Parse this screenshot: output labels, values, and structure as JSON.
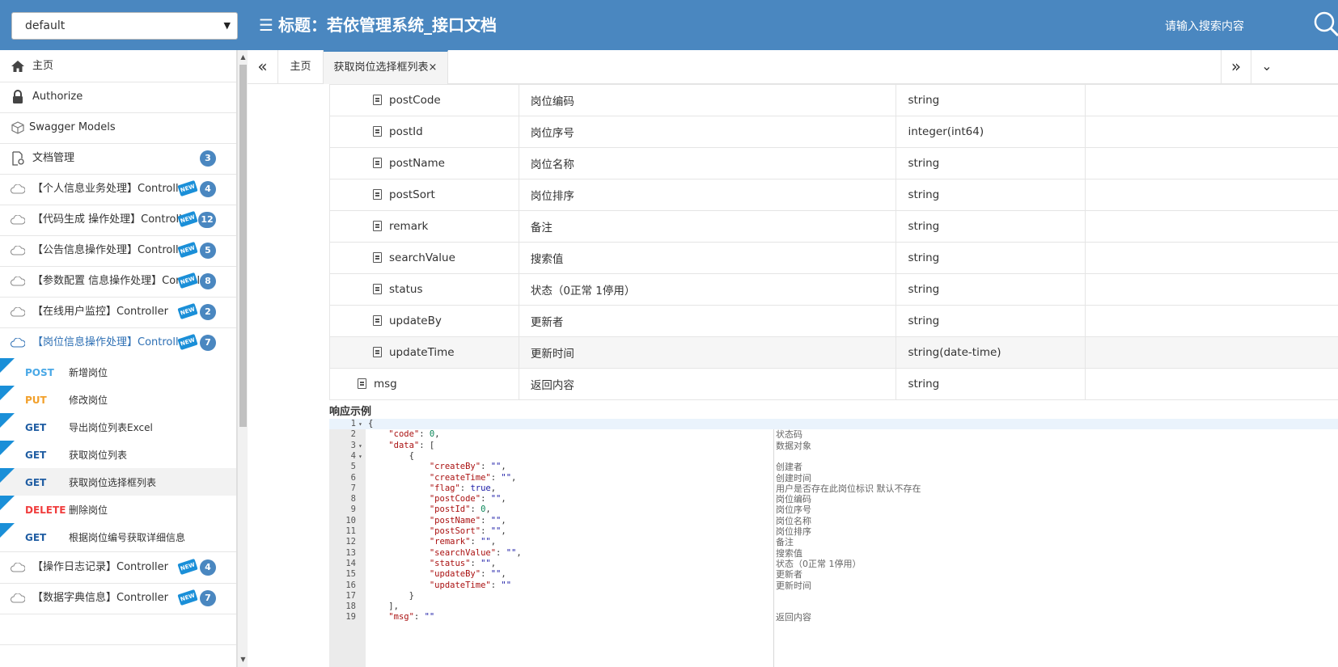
{
  "header": {
    "group_select": "default",
    "title": "标题：若依管理系统_接口文档",
    "search_placeholder": "请输入搜索内容"
  },
  "sidebar": {
    "items": [
      {
        "label": "主页",
        "icon": "home-icon"
      },
      {
        "label": "Authorize",
        "icon": "lock-icon"
      },
      {
        "label": "Swagger Models",
        "icon": "cube-icon"
      },
      {
        "label": "文档管理",
        "icon": "doc-settings-icon",
        "badge": "3"
      },
      {
        "label": "【个人信息业务处理】Controller",
        "icon": "cloud-icon",
        "badge": "4",
        "new": "NEW"
      },
      {
        "label": "【代码生成 操作处理】Controller",
        "icon": "cloud-icon",
        "badge": "12",
        "new": "NEW"
      },
      {
        "label": "【公告信息操作处理】Controller",
        "icon": "cloud-icon",
        "badge": "5",
        "new": "NEW"
      },
      {
        "label": "【参数配置 信息操作处理】Controller",
        "icon": "cloud-icon",
        "badge": "8",
        "new": "NEW"
      },
      {
        "label": "【在线用户监控】Controller",
        "icon": "cloud-icon",
        "badge": "2",
        "new": "NEW"
      },
      {
        "label": "【岗位信息操作处理】Controller",
        "icon": "cloud-icon",
        "badge": "7",
        "new": "NEW"
      }
    ],
    "apis": [
      {
        "method": "POST",
        "desc": "新增岗位"
      },
      {
        "method": "PUT",
        "desc": "修改岗位"
      },
      {
        "method": "GET",
        "desc": "导出岗位列表Excel"
      },
      {
        "method": "GET",
        "desc": "获取岗位列表"
      },
      {
        "method": "GET",
        "desc": "获取岗位选择框列表"
      },
      {
        "method": "DELETE",
        "desc": "删除岗位"
      },
      {
        "method": "GET",
        "desc": "根据岗位编号获取详细信息"
      }
    ],
    "items_after": [
      {
        "label": "【操作日志记录】Controller",
        "badge": "4",
        "new": "NEW"
      },
      {
        "label": "【数据字典信息】Controller",
        "badge": "7",
        "new": "NEW"
      }
    ]
  },
  "tabs": {
    "home": "主页",
    "current": "获取岗位选择框列表",
    "close": "×"
  },
  "params": [
    {
      "name": "postCode",
      "desc": "岗位编码",
      "type": "string"
    },
    {
      "name": "postId",
      "desc": "岗位序号",
      "type": "integer(int64)"
    },
    {
      "name": "postName",
      "desc": "岗位名称",
      "type": "string"
    },
    {
      "name": "postSort",
      "desc": "岗位排序",
      "type": "string"
    },
    {
      "name": "remark",
      "desc": "备注",
      "type": "string"
    },
    {
      "name": "searchValue",
      "desc": "搜索值",
      "type": "string"
    },
    {
      "name": "status",
      "desc": "状态（0正常 1停用）",
      "type": "string"
    },
    {
      "name": "updateBy",
      "desc": "更新者",
      "type": "string"
    },
    {
      "name": "updateTime",
      "desc": "更新时间",
      "type": "string(date-time)"
    },
    {
      "name": "msg",
      "desc": "返回内容",
      "type": "string"
    }
  ],
  "response_example_title": "响应示例",
  "code_comments": {
    "2": "状态码",
    "3": "数据对象",
    "5": "创建者",
    "6": "创建时间",
    "7": "用户是否存在此岗位标识 默认不存在",
    "8": "岗位编码",
    "9": "岗位序号",
    "10": "岗位名称",
    "11": "岗位排序",
    "12": "备注",
    "13": "搜索值",
    "14": "状态（0正常 1停用）",
    "15": "更新者",
    "16": "更新时间",
    "19": "返回内容"
  },
  "colors": {
    "header": "#4a87c0",
    "post": "#49a8e6",
    "put": "#f2a02a",
    "get": "#215ea3",
    "delete": "#f03d3d"
  }
}
